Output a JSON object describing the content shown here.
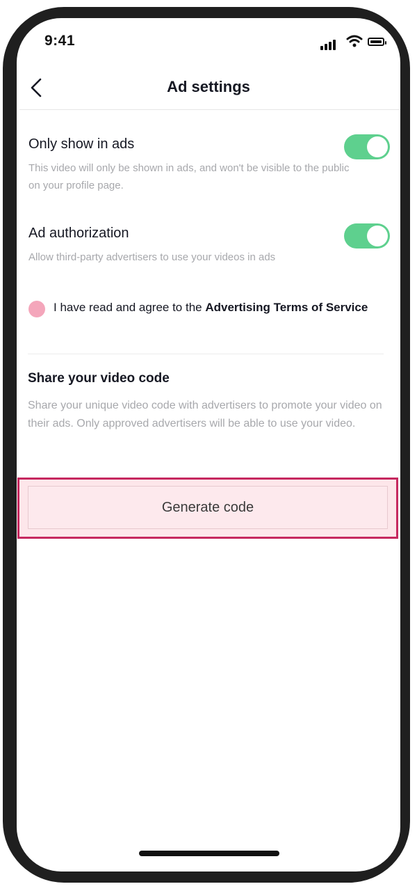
{
  "status_bar": {
    "time": "9:41",
    "icons": [
      "signal-icon",
      "wifi-icon",
      "battery-icon"
    ]
  },
  "header": {
    "back_icon": "chevron-left-icon",
    "title": "Ad settings"
  },
  "settings": [
    {
      "title": "Only show in ads",
      "description": "This video will only be shown in ads, and won't be visible to the public on your profile page.",
      "enabled": true
    },
    {
      "title": "Ad authorization",
      "description": "Allow third-party advertisers to use your videos in ads",
      "enabled": true
    }
  ],
  "agreement": {
    "checked": true,
    "text": "I have read and agree to the ",
    "link_text": "Advertising Terms of Service"
  },
  "share_section": {
    "title": "Share your video code",
    "description": "Share your unique video code with advertisers to promote your video on their ads. Only approved advertisers will be able to use your video.",
    "button_label": "Generate code"
  },
  "colors": {
    "toggle_on": "#5ed08e",
    "checkbox": "#f4a6bb",
    "highlight_border": "#c6285f",
    "button_bg": "#fde9ed"
  }
}
